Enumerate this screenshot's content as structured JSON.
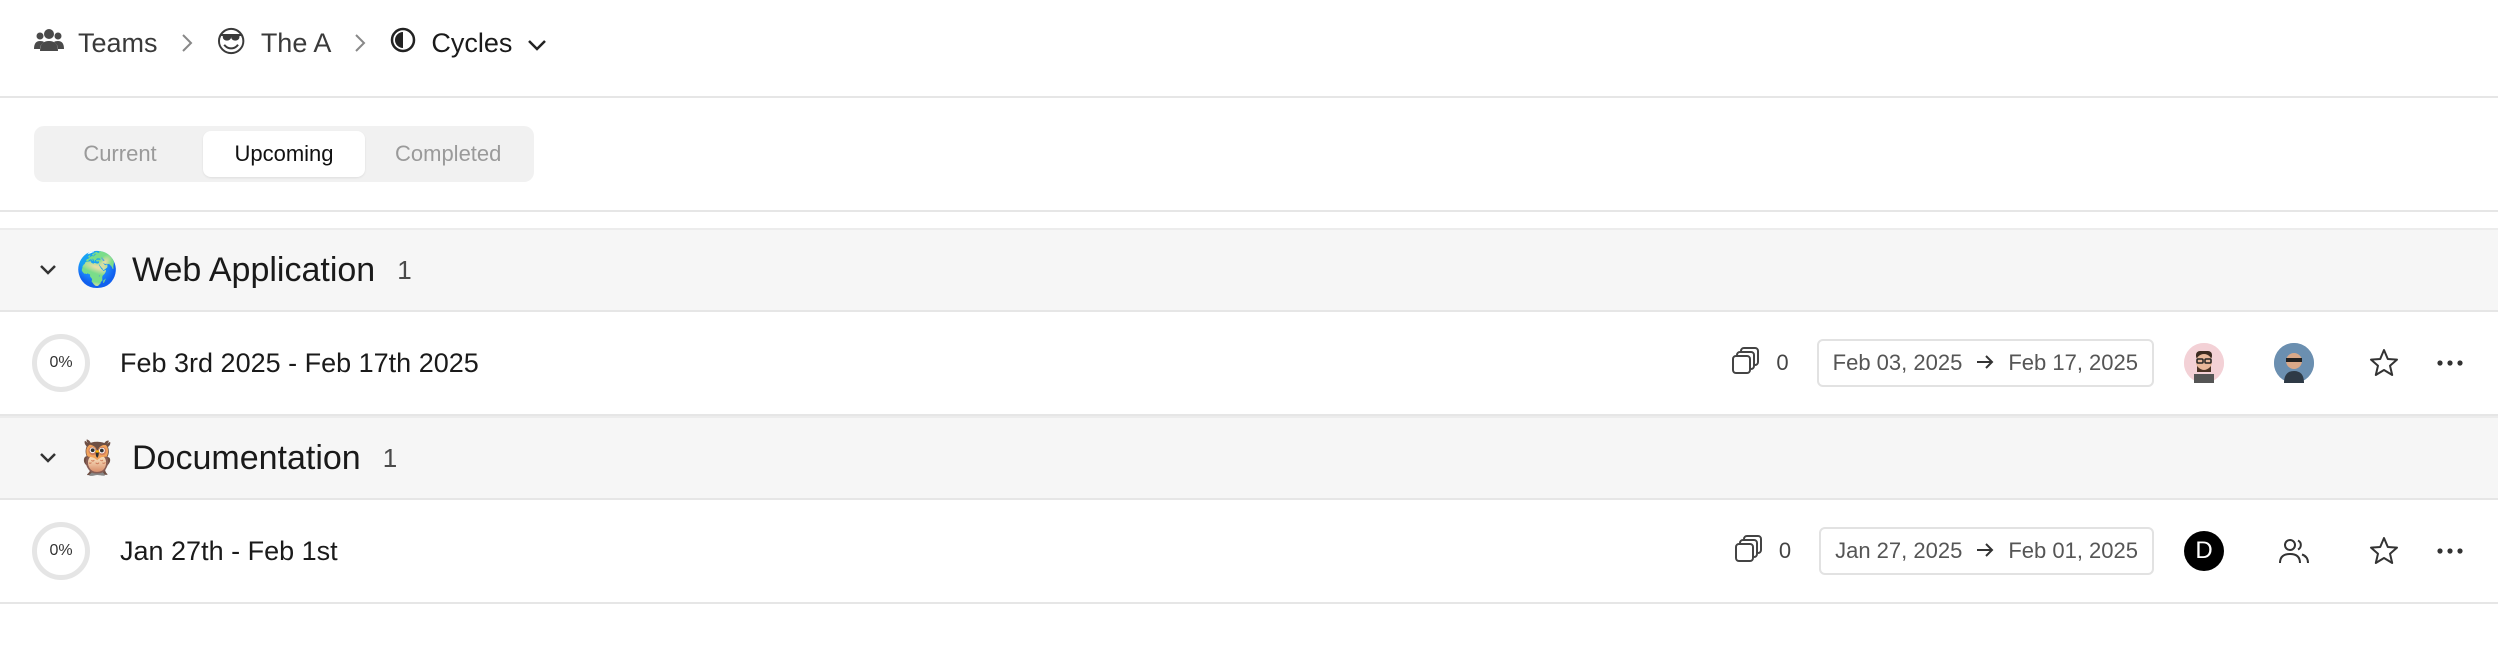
{
  "breadcrumb": {
    "teams_label": "Teams",
    "team_name": "The A",
    "team_emoji": "😎",
    "page_label": "Cycles"
  },
  "tabs": [
    {
      "label": "Current",
      "active": false
    },
    {
      "label": "Upcoming",
      "active": true
    },
    {
      "label": "Completed",
      "active": false
    }
  ],
  "groups": [
    {
      "title": "Web Application",
      "emoji": "🌍",
      "count": "1",
      "cycle": {
        "progress": "0%",
        "name": "Feb 3rd 2025 - Feb 17th 2025",
        "issues": "0",
        "start": "Feb 03, 2025",
        "end": "Feb 17, 2025"
      }
    },
    {
      "title": "Documentation",
      "emoji": "🦉",
      "count": "1",
      "cycle": {
        "progress": "0%",
        "name": "Jan 27th - Feb 1st",
        "issues": "0",
        "start": "Jan 27, 2025",
        "end": "Feb 01, 2025",
        "lead_initial": "D"
      }
    }
  ],
  "colors": {
    "group_bg": "#f6f6f6",
    "border": "#e6e6e6",
    "lead_avatar": "#000000"
  }
}
